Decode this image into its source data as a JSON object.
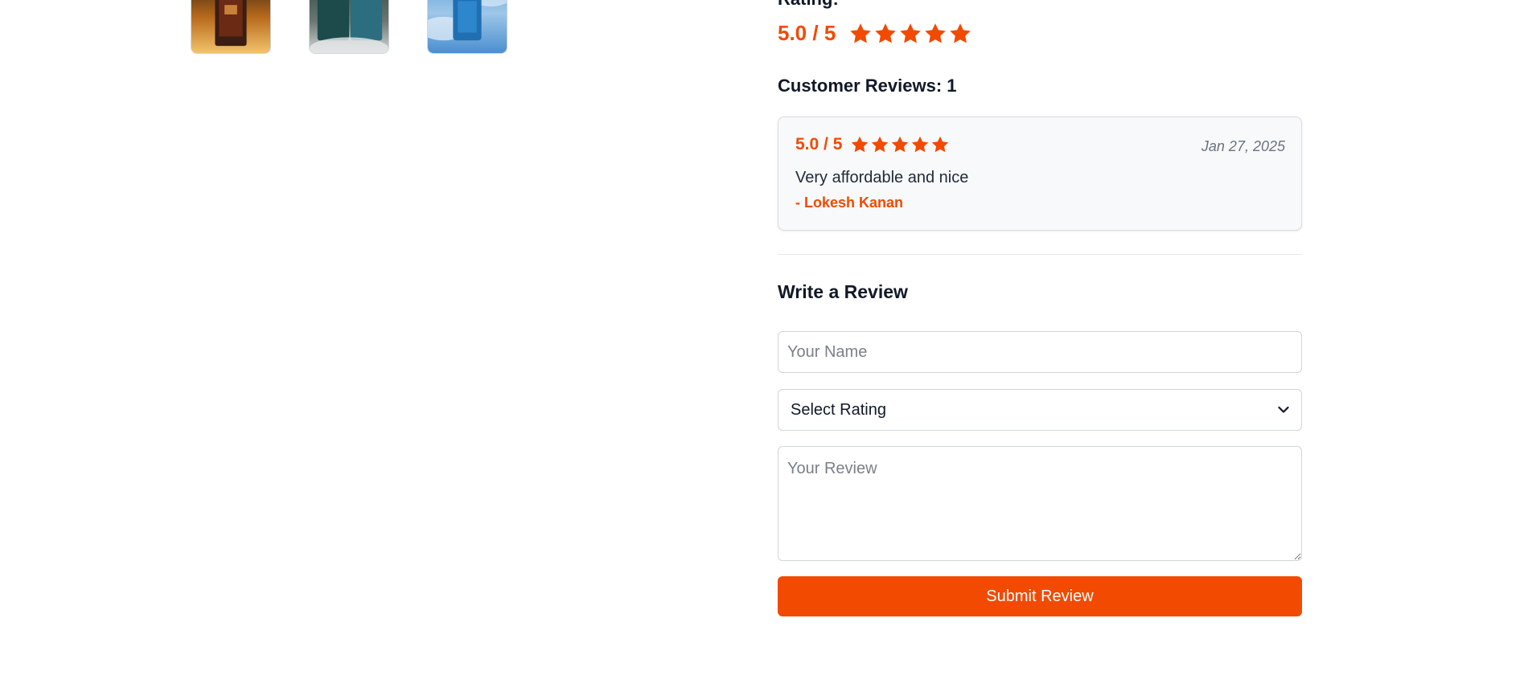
{
  "gallery": {
    "thumbnails": [
      {
        "icon": "perfume-bottle-amber-thumbnail"
      },
      {
        "icon": "perfume-bottle-teal-thumbnail"
      },
      {
        "icon": "perfume-bottle-blue-thumbnail"
      }
    ]
  },
  "product_rating": {
    "heading": "Rating:",
    "value_label": "5.0 / 5",
    "stars": 5,
    "max_stars": 5,
    "color": "#f24a00"
  },
  "reviews": {
    "count_label": "Customer Reviews: 1",
    "items": [
      {
        "rating_label": "5.0 / 5",
        "stars": 5,
        "date": "Jan 27, 2025",
        "text": "Very affordable and nice",
        "author": "- Lokesh Kanan"
      }
    ]
  },
  "write_review": {
    "heading": "Write a Review",
    "name_placeholder": "Your Name",
    "rating_select_value": "Select Rating",
    "review_placeholder": "Your Review",
    "submit_label": "Submit Review",
    "accent": "#f24a00"
  }
}
